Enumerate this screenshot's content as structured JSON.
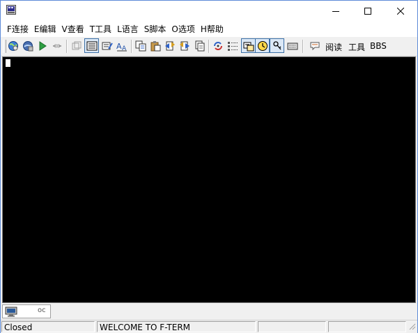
{
  "window": {
    "title": "",
    "icon": "fterm-app-icon",
    "controls": [
      "minimize-icon",
      "maximize-icon",
      "close-icon"
    ]
  },
  "menu": [
    {
      "id": "connect",
      "label": "F连接"
    },
    {
      "id": "edit",
      "label": "E编辑"
    },
    {
      "id": "view",
      "label": "V查看"
    },
    {
      "id": "tools",
      "label": "T工具"
    },
    {
      "id": "language",
      "label": "L语言"
    },
    {
      "id": "script",
      "label": "S脚本"
    },
    {
      "id": "options",
      "label": "O选项"
    },
    {
      "id": "help",
      "label": "H帮助"
    }
  ],
  "toolbar": {
    "icons": [
      "connect-globe-icon",
      "quick-connect-globe-icon",
      "play-icon",
      "disconnect-icon",
      "clone-session-icon",
      "screen-view-icon",
      "edit-terminal-icon",
      "font-icon",
      "copy-icon",
      "paste-icon",
      "send-file-icon",
      "receive-file-icon",
      "print-icon",
      "refresh-icon",
      "list-icon",
      "auto-reply-icon",
      "clock-icon",
      "key-icon",
      "keyboard-icon",
      "message-icon"
    ],
    "text_buttons": [
      {
        "id": "read",
        "label": "阅读"
      },
      {
        "id": "tools",
        "label": "工具"
      },
      {
        "id": "bbs",
        "label": "BBS"
      }
    ]
  },
  "session_tab": {
    "name": "oc",
    "icon": "monitor-icon"
  },
  "status": {
    "connection": "Closed",
    "message": "WELCOME TO F-TERM",
    "pane3": "",
    "pane4": ""
  },
  "colors": {
    "terminal_bg": "#000000",
    "cursor": "#ffffff",
    "chrome": "#f0f0f0",
    "window_border": "#5c8ad8"
  }
}
